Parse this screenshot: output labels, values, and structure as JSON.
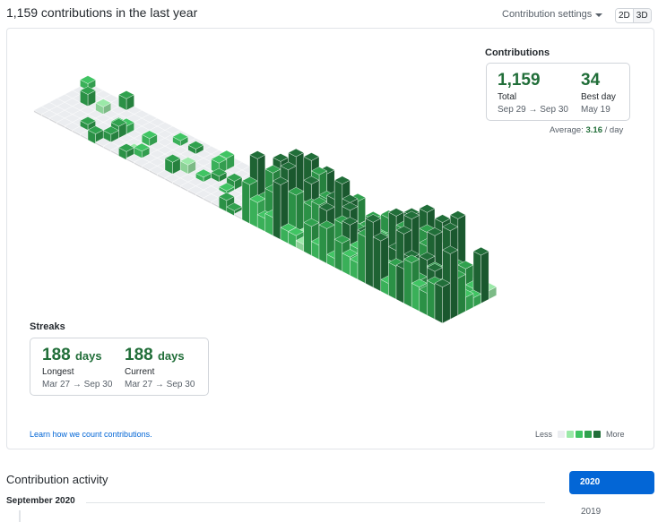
{
  "header": {
    "title": "1,159 contributions in the last year",
    "settings_label": "Contribution settings",
    "view_2d": "2D",
    "view_3d": "3D"
  },
  "contributions": {
    "heading": "Contributions",
    "total_value": "1,159",
    "total_label": "Total",
    "total_range": "Sep 29 → Sep 30",
    "best_value": "34",
    "best_label": "Best day",
    "best_date": "May 19",
    "average_label": "Average:",
    "average_value": "3.16",
    "average_unit": "/ day"
  },
  "streaks": {
    "heading": "Streaks",
    "longest_value": "188",
    "longest_unit": "days",
    "longest_label": "Longest",
    "longest_range": "Mar 27 → Sep 30",
    "current_value": "188",
    "current_unit": "days",
    "current_label": "Current",
    "current_range": "Mar 27 → Sep 30"
  },
  "footer": {
    "learn_link": "Learn how we count contributions.",
    "less": "Less",
    "more": "More"
  },
  "activity": {
    "heading": "Contribution activity",
    "month": "September 2020",
    "years": [
      "2020",
      "2019"
    ]
  },
  "colors": {
    "empty": "#ebedf0",
    "level1": "#9be9a8",
    "level2": "#40c463",
    "level3": "#30a14e",
    "level4": "#216e39",
    "accent": "#0366d6"
  }
}
